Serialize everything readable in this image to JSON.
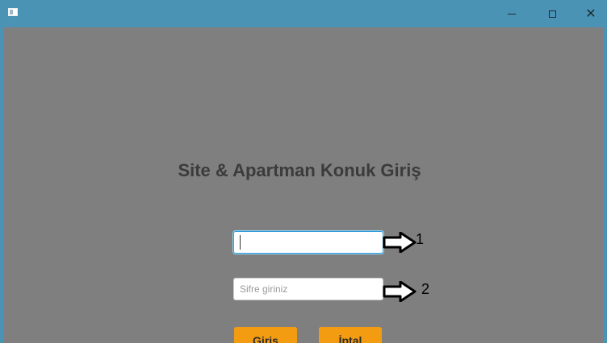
{
  "window": {
    "minimize_icon": "minimize-icon",
    "maximize_icon": "maximize-icon",
    "close_glyph": "✕",
    "accent_color": "#4a93b5",
    "background_color": "#7f7f7f"
  },
  "main": {
    "title": "Site & Apartman Konuk Giriş",
    "username": {
      "value": "",
      "placeholder": ""
    },
    "password": {
      "value": "",
      "placeholder": "Sifre giriniz"
    },
    "annotations": [
      {
        "label": "1",
        "icon": "arrow-right-icon"
      },
      {
        "label": "2",
        "icon": "arrow-right-icon"
      }
    ],
    "buttons": {
      "login_label": "Giriş",
      "cancel_label": "İptal",
      "color": "#f39c12"
    }
  }
}
